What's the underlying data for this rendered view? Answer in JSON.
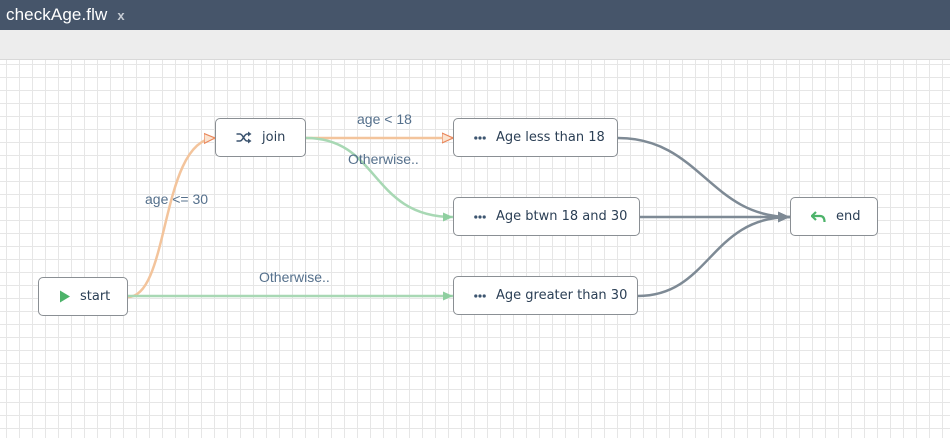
{
  "tab": {
    "title": "checkAge.flw",
    "close_glyph": "x"
  },
  "colors": {
    "tabbar": "#46556a",
    "accept_edge": "#f3c49c",
    "otherwise_edge": "#a8d8b4",
    "end_edge": "#7e8a95",
    "start_icon": "#4db36a",
    "end_icon": "#4db36a",
    "edge_label": "#55708c"
  },
  "nodes": {
    "start": {
      "label": "start",
      "icon": "play-icon"
    },
    "join": {
      "label": "join",
      "icon": "shuffle-icon"
    },
    "age_less": {
      "label": "Age less than 18",
      "icon": "ellipsis-icon"
    },
    "age_btwn": {
      "label": "Age btwn 18 and 30",
      "icon": "ellipsis-icon"
    },
    "age_greater": {
      "label": "Age greater than 30",
      "icon": "ellipsis-icon"
    },
    "end": {
      "label": "end",
      "icon": "return-arrow-icon"
    }
  },
  "edges": {
    "age_lte_30": "age <= 30",
    "age_lt_18": "age < 18",
    "join_otherwise": "Otherwise..",
    "start_otherwise": "Otherwise.."
  }
}
